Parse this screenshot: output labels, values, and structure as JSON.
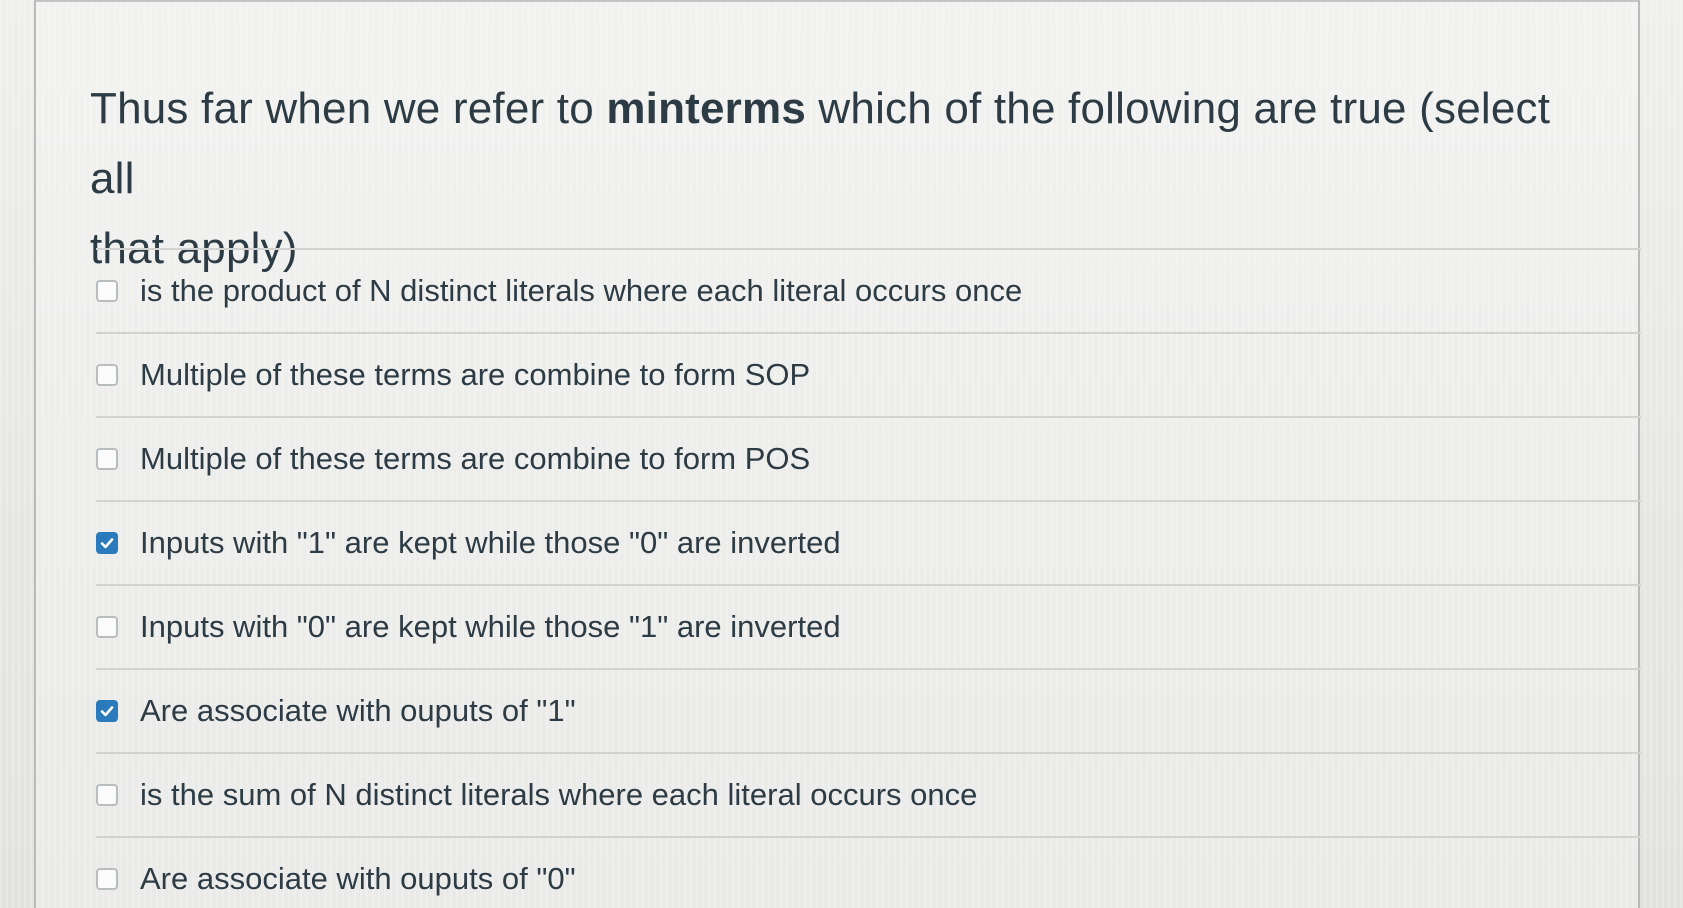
{
  "question": {
    "prefix": "Thus far when we refer to ",
    "bold": "minterms",
    "suffix_line1": " which of the following are true (select all",
    "line2": "that apply)"
  },
  "answers": [
    {
      "label": "is the product of N distinct literals where each literal occurs once",
      "checked": false,
      "icon": "checkbox-empty-icon"
    },
    {
      "label": "Multiple of these terms are combine to form SOP",
      "checked": false,
      "icon": "checkbox-empty-icon"
    },
    {
      "label": "Multiple of these terms are combine to form POS",
      "checked": false,
      "icon": "checkbox-empty-icon"
    },
    {
      "label": "Inputs with \"1\" are kept while those \"0\" are inverted",
      "checked": true,
      "icon": "checkmark-icon"
    },
    {
      "label": "Inputs with \"0\" are kept while those \"1\" are inverted",
      "checked": false,
      "icon": "checkbox-empty-icon"
    },
    {
      "label": "Are associate with ouputs of \"1\"",
      "checked": true,
      "icon": "checkmark-icon"
    },
    {
      "label": "is the sum of N distinct literals where each literal occurs once",
      "checked": false,
      "icon": "checkbox-empty-icon"
    },
    {
      "label": "Are associate with ouputs of \"0\"",
      "checked": false,
      "icon": "checkbox-empty-icon"
    }
  ],
  "colors": {
    "text": "#2d3b45",
    "checkbox_checked": "#2b7abc",
    "divider": "#d2d2d0"
  }
}
